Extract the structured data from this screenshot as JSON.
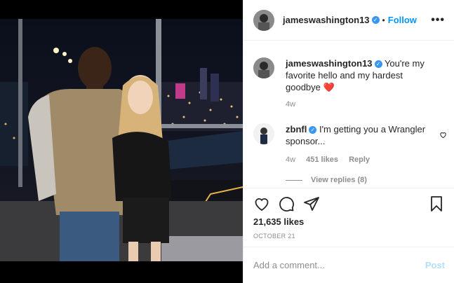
{
  "post": {
    "username": "jameswashington13",
    "follow_label": "Follow",
    "caption": "You're my favorite hello and my hardest goodbye",
    "caption_emoji": "❤️",
    "caption_time": "4w"
  },
  "comments": [
    {
      "username": "zbnfl",
      "text": "I'm getting you a Wrangler sponsor...",
      "time": "4w",
      "likes": "451 likes",
      "reply_label": "Reply",
      "view_replies": "View replies (8)"
    }
  ],
  "engagement": {
    "likes": "21,635 likes",
    "date": "OCTOBER 21"
  },
  "add_comment": {
    "placeholder": "Add a comment...",
    "post_label": "Post"
  },
  "colors": {
    "accent": "#0095f6",
    "verified": "#3897f0",
    "heart": "#ed4956",
    "post_disabled": "#b2dffc"
  },
  "icons": [
    "more-options-icon",
    "verified-badge-icon",
    "heart-icon",
    "comment-icon",
    "share-icon",
    "bookmark-icon"
  ]
}
